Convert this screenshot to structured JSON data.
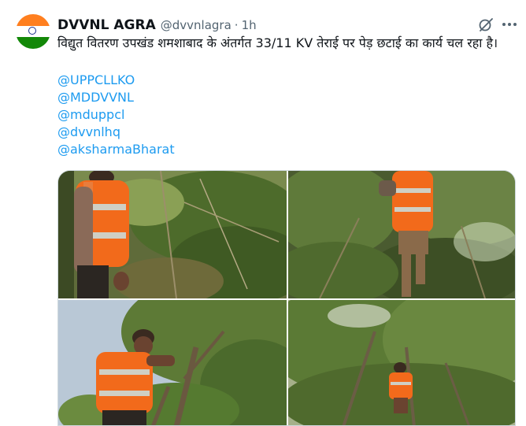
{
  "tweet": {
    "display_name": "DVVNL AGRA",
    "handle": "@dvvnlagra",
    "separator": "·",
    "time": "1h",
    "text": "विद्युत वितरण उपखंड शमशाबाद के अंतर्गत 33/11 KV तेराई पर पेड़ छटाई का कार्य चल रहा है।",
    "mentions": [
      "@UPPCLLKO",
      "@MDDVVNL",
      "@mduppcl",
      "@dvvnlhq",
      "@aksharmaBharat"
    ],
    "more_icon": "more-horizontal-icon",
    "grok_icon": "grok-icon"
  },
  "colors": {
    "link": "#1d9bf0",
    "muted": "#536471",
    "text": "#0f1419",
    "vest": "#f26a1b"
  }
}
